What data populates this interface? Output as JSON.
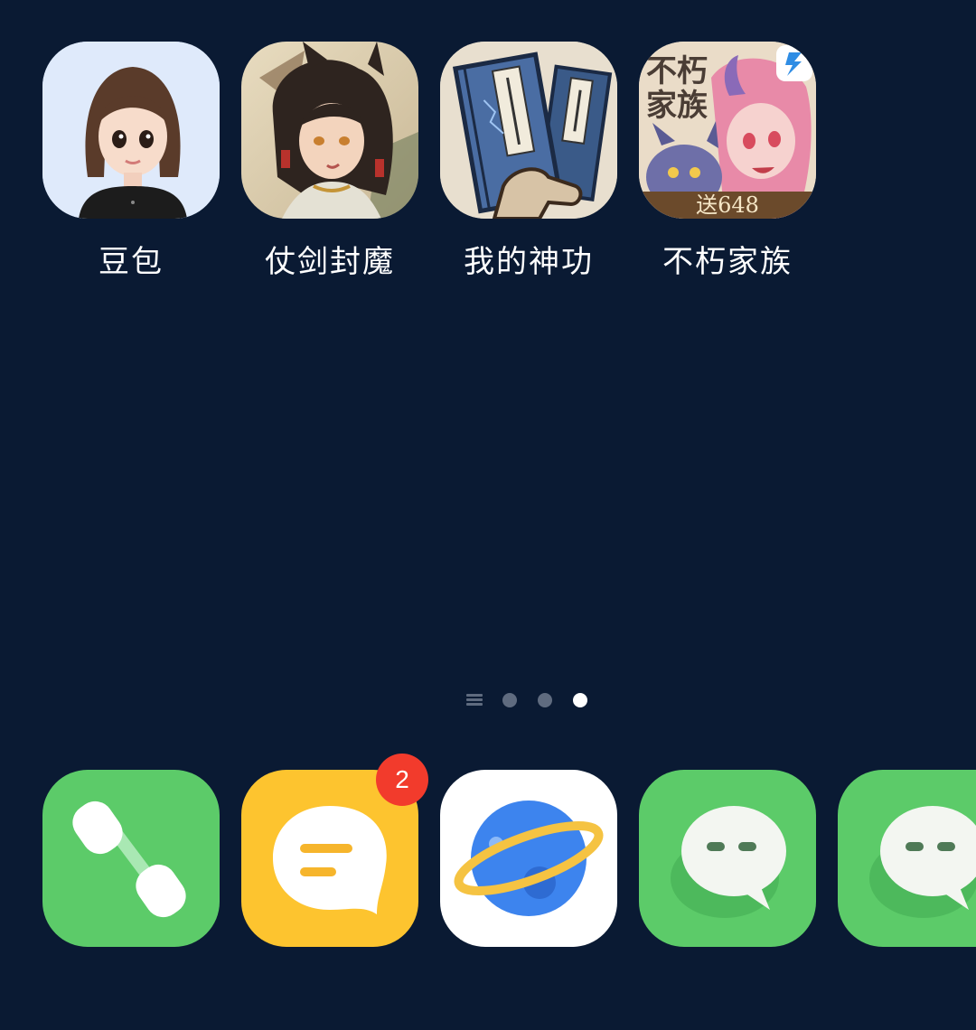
{
  "home": {
    "apps": [
      {
        "label": "豆包",
        "icon": "doubao-avatar-icon"
      },
      {
        "label": "仗剑封魔",
        "icon": "warrior-girl-icon"
      },
      {
        "label": "我的神功",
        "icon": "martial-books-icon"
      },
      {
        "label": "不朽家族",
        "icon": "fantasy-family-icon",
        "overlay_text": "送648",
        "corner_title": "不朽家族"
      }
    ]
  },
  "pager": {
    "pages": 3,
    "active_index": 2
  },
  "dock": {
    "items": [
      {
        "name": "phone",
        "icon": "phone-icon"
      },
      {
        "name": "messages",
        "icon": "message-icon",
        "badge": "2"
      },
      {
        "name": "browser",
        "icon": "planet-browser-icon"
      },
      {
        "name": "chat-1",
        "icon": "chat-bubble-icon"
      },
      {
        "name": "chat-2",
        "icon": "chat-bubble-icon"
      }
    ]
  },
  "colors": {
    "background": "#0a1a33",
    "dock_green": "#5ccb69",
    "message_yellow": "#fdc42f",
    "badge_red": "#f23b2c"
  }
}
